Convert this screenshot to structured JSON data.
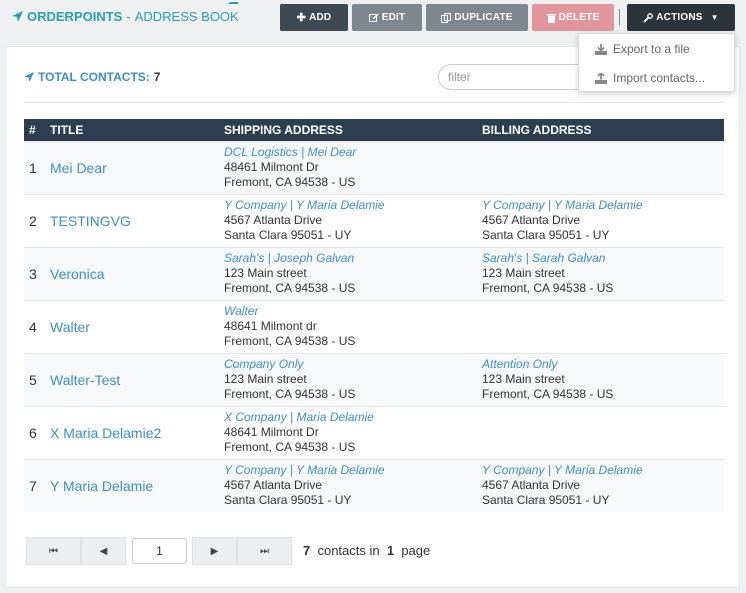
{
  "header": {
    "brand": "ORDERPOINTS",
    "separator": "-",
    "section": "ADDRESS BOOK",
    "buttons": {
      "add": "ADD",
      "edit": "EDIT",
      "duplicate": "DUPLICATE",
      "delete": "DELETE",
      "actions": "ACTIONS"
    }
  },
  "actions_menu": {
    "items": [
      {
        "label": "Export to a file",
        "icon": "download-icon"
      },
      {
        "label": "Import contacts...",
        "icon": "upload-icon"
      }
    ]
  },
  "summary": {
    "label": "TOTAL CONTACTS:",
    "count": "7"
  },
  "filter": {
    "placeholder": "filter",
    "value": ""
  },
  "table": {
    "columns": [
      "#",
      "TITLE",
      "SHIPPING ADDRESS",
      "BILLING ADDRESS"
    ],
    "rows": [
      {
        "num": "1",
        "title": "Mei Dear",
        "ship": {
          "name": "DCL Logistics | Mei Dear",
          "line1": "48461 Milmont Dr",
          "line2": "Fremont, CA 94538 - US"
        },
        "bill": {
          "name": "",
          "line1": "",
          "line2": ""
        }
      },
      {
        "num": "2",
        "title": "TESTINGVG",
        "ship": {
          "name": "Y Company | Y Maria Delamie",
          "line1": "4567 Atlanta Drive",
          "line2": "Santa Clara 95051 - UY"
        },
        "bill": {
          "name": "Y Company | Y Maria Delamie",
          "line1": "4567 Atlanta Drive",
          "line2": "Santa Clara 95051 - UY"
        }
      },
      {
        "num": "3",
        "title": "Veronica",
        "ship": {
          "name": "Sarah's | Joseph Galvan",
          "line1": "123 Main street",
          "line2": "Fremont, CA 94538 - US"
        },
        "bill": {
          "name": "Sarah's | Sarah Galvan",
          "line1": "123 Main street",
          "line2": "Fremont, CA 94538 - US"
        }
      },
      {
        "num": "4",
        "title": "Walter",
        "ship": {
          "name": "Walter",
          "line1": "48641 Milmont dr",
          "line2": "Fremont, CA 94538 - US"
        },
        "bill": {
          "name": "",
          "line1": "",
          "line2": ""
        }
      },
      {
        "num": "5",
        "title": "Walter-Test",
        "ship": {
          "name": "Company Only",
          "line1": "123 Main street",
          "line2": "Fremont, CA 94538 - US"
        },
        "bill": {
          "name": "Attention Only",
          "line1": "123 Main street",
          "line2": "Fremont, CA 94538 - US"
        }
      },
      {
        "num": "6",
        "title": "X Maria Delamie2",
        "ship": {
          "name": "X Company | Maria Delamie",
          "line1": "48641 Milmont Dr",
          "line2": "Fremont, CA 94538 - US"
        },
        "bill": {
          "name": "",
          "line1": "",
          "line2": ""
        }
      },
      {
        "num": "7",
        "title": "Y Maria Delamie",
        "ship": {
          "name": "Y Company | Y Maria Delamie",
          "line1": "4567 Atlanta Drive",
          "line2": "Santa Clara 95051 - UY"
        },
        "bill": {
          "name": "Y Company | Y Maria Delamie",
          "line1": "4567 Atlanta Drive",
          "line2": "Santa Clara 95051 - UY"
        }
      }
    ]
  },
  "pager": {
    "current_page": "1",
    "total_contacts": "7",
    "contacts_in": "contacts in",
    "page_count": "1",
    "page_word": "page"
  },
  "colors": {
    "brand": "#2aa0ad",
    "link": "#3d8fc9",
    "table_header": "#2c3e50",
    "delete": "#e0969a",
    "dark_button": "#3e4954"
  }
}
